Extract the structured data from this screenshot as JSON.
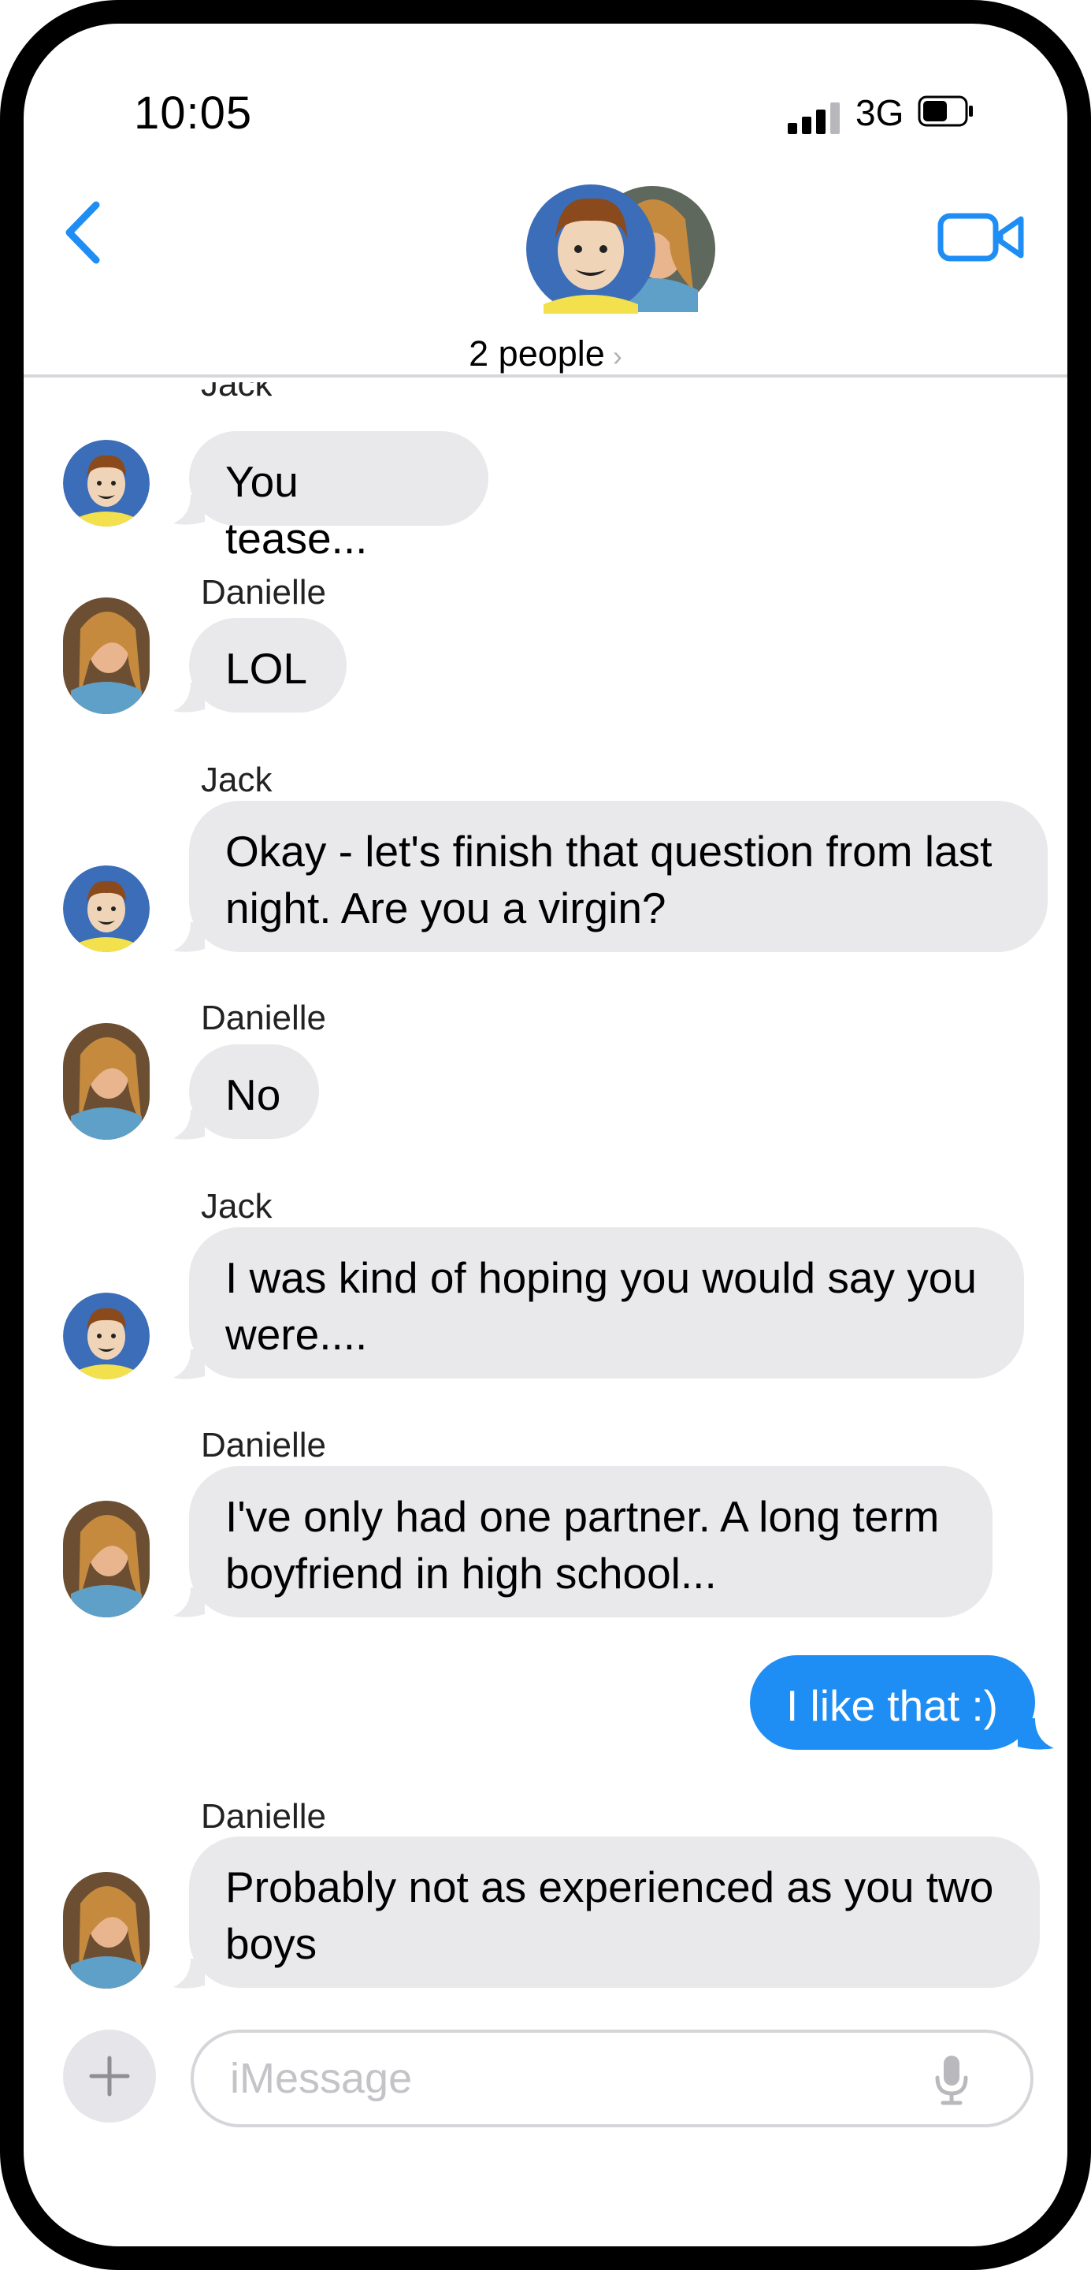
{
  "status_bar": {
    "time": "10:05",
    "network": "3G",
    "signal_icon": "cellular-signal-icon",
    "battery_icon": "battery-icon"
  },
  "header": {
    "back_icon": "chevron-left-icon",
    "video_icon": "video-camera-icon",
    "participants_label": "2 people",
    "participants_chevron": "›"
  },
  "messages": [
    {
      "sender": "Jack",
      "text": "You tease...",
      "direction": "incoming"
    },
    {
      "sender": "Danielle",
      "text": "LOL",
      "direction": "incoming"
    },
    {
      "sender": "Jack",
      "text": "Okay - let's finish that question from last night.  Are you a virgin?",
      "direction": "incoming"
    },
    {
      "sender": "Danielle",
      "text": "No",
      "direction": "incoming"
    },
    {
      "sender": "Jack",
      "text": "I was kind of hoping you would say you were....",
      "direction": "incoming"
    },
    {
      "sender": "Danielle",
      "text": "I've only had one partner.  A long term boyfriend in high school...",
      "direction": "incoming"
    },
    {
      "sender": "",
      "text": "I like that :)",
      "direction": "outgoing"
    },
    {
      "sender": "Danielle",
      "text": "Probably not as experienced as you two boys",
      "direction": "incoming"
    }
  ],
  "composer": {
    "placeholder": "iMessage",
    "plus_icon": "plus-icon",
    "mic_icon": "microphone-icon"
  },
  "colors": {
    "accent": "#1e8ef5",
    "incoming_bubble": "#e9e9eb",
    "outgoing_bubble": "#1e8ef5"
  }
}
